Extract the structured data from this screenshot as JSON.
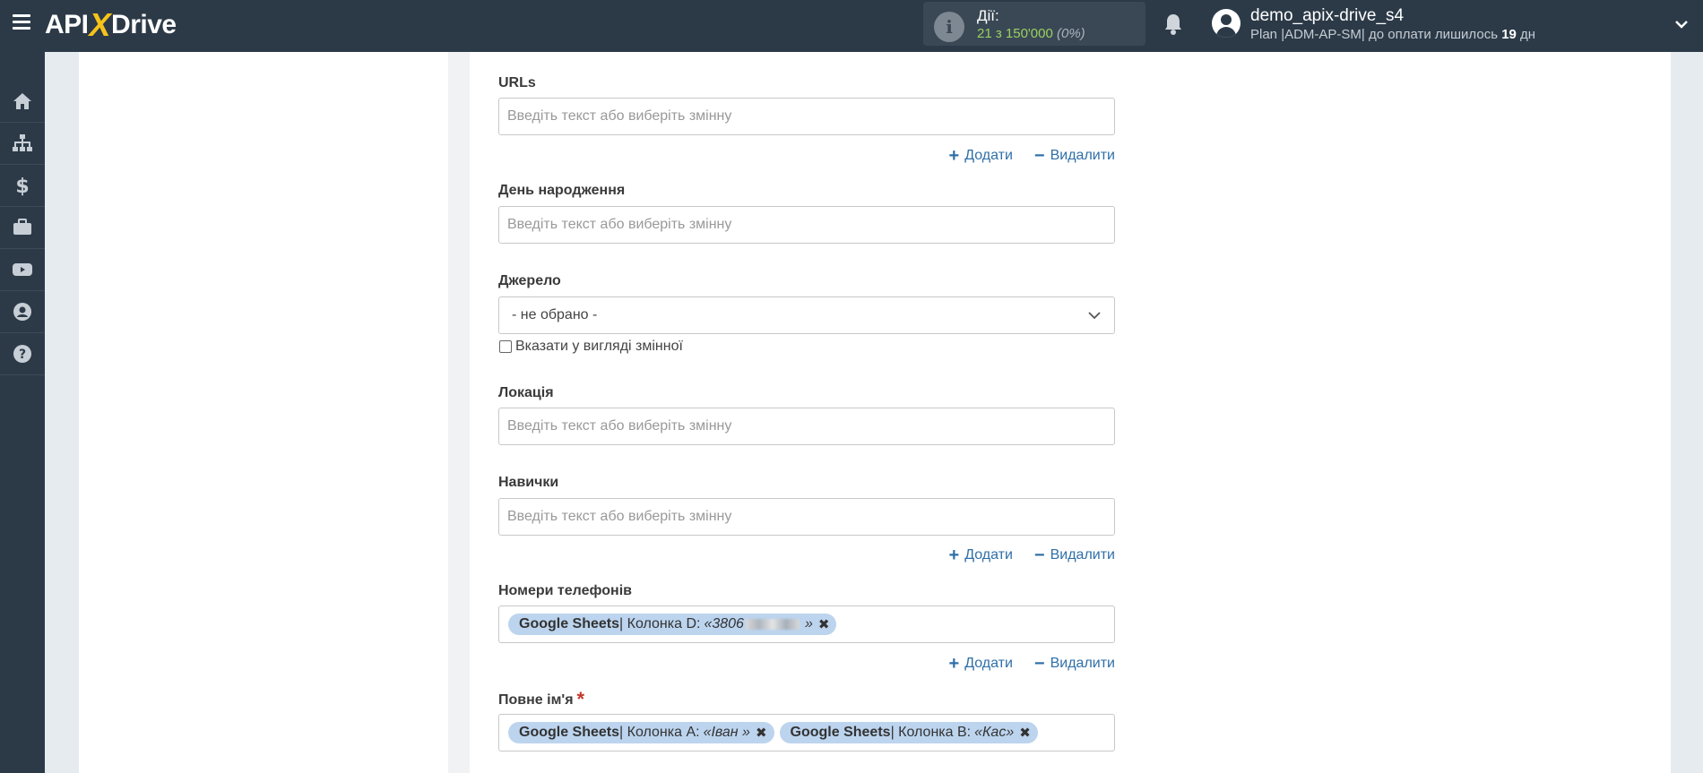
{
  "topbar": {
    "logo_left": "API",
    "logo_x": "X",
    "logo_right": "Drive",
    "actions_label": "Дії:",
    "actions_count": "21 з 150'000",
    "actions_percent": "(0%)",
    "username": "demo_apix-drive_s4",
    "plan_prefix": "Plan |ADM-AP-SM| до оплати лишилось ",
    "plan_days": "19",
    "plan_suffix": " дн"
  },
  "sidebar": {
    "items": [
      "home-icon",
      "sitemap-icon",
      "dollar-icon",
      "briefcase-icon",
      "youtube-icon",
      "user-circle-icon",
      "help-icon"
    ]
  },
  "form": {
    "placeholder": "Введіть текст або виберіть змінну",
    "add_label": "Додати",
    "remove_label": "Видалити",
    "urls": {
      "label": "URLs"
    },
    "birthday": {
      "label": "День народження"
    },
    "source": {
      "label": "Джерело",
      "selected": "- не обрано -",
      "checkbox_label": "Вказати у вигляді змінної"
    },
    "location": {
      "label": "Локація"
    },
    "skills": {
      "label": "Навички"
    },
    "phones": {
      "label": "Номери телефонів",
      "tags": [
        {
          "source": "Google Sheets",
          "column": " | Колонка D: ",
          "value": "«3806",
          "value_end": "»"
        }
      ]
    },
    "fullname": {
      "label": "Повне ім'я",
      "required_mark": "*",
      "tags": [
        {
          "source": "Google Sheets",
          "column": " | Колонка A: ",
          "value": "«Іван »"
        },
        {
          "source": "Google Sheets",
          "column": " | Колонка B: ",
          "value": "«Кас»"
        }
      ]
    }
  },
  "colors": {
    "topbar": "#2c3a48",
    "accent_yellow": "#f7c31a",
    "link_blue": "#2f6fa8",
    "tag_bg": "#bcd4ee",
    "count_green": "#9ad05f"
  }
}
